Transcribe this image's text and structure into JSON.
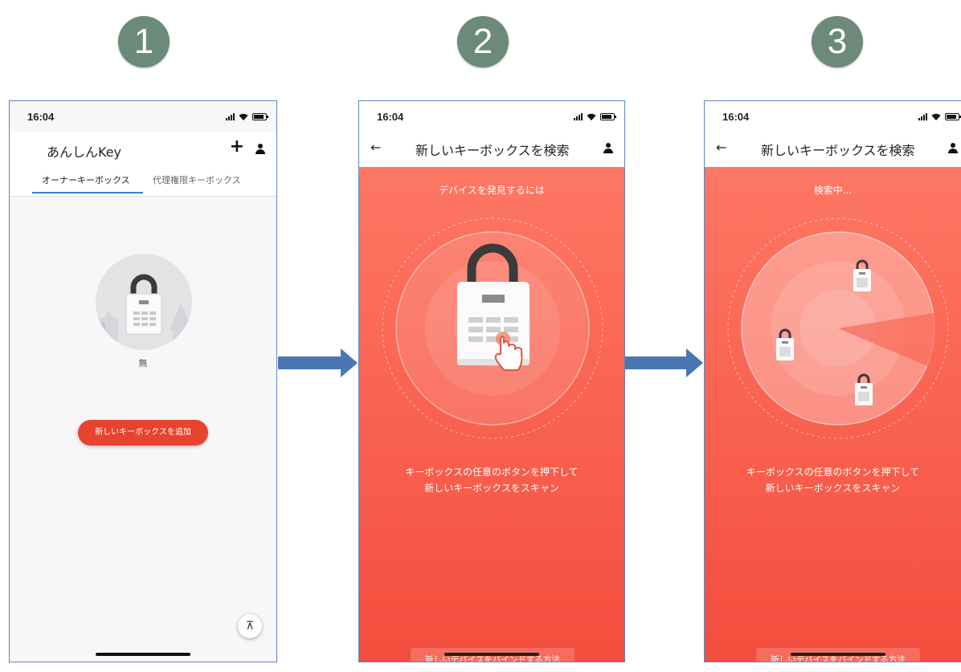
{
  "steps": [
    "1",
    "2",
    "3"
  ],
  "status_bar": {
    "time": "16:04"
  },
  "screen1": {
    "app_title": "あんしんKey",
    "plus_label": "+",
    "tabs": [
      "オーナーキーボックス",
      "代理権限キーボックス"
    ],
    "empty_text": "無",
    "add_button": "新しいキーボックスを追加",
    "scroll_top_icon": "⊼"
  },
  "screen2": {
    "back": "←",
    "title": "新しいキーボックスを検索",
    "subtitle": "デバイスを発見するには",
    "instruction_line1": "キーボックスの任意のボタンを押下して",
    "instruction_line2": "新しいキーボックスをスキャン",
    "help_button": "新しいデバイスをバインドする方法"
  },
  "screen3": {
    "back": "←",
    "title": "新しいキーボックスを検索",
    "subtitle": "検索中...",
    "instruction_line1": "キーボックスの任意のボタンを押下して",
    "instruction_line2": "新しいキーボックスをスキャン",
    "help_button": "新しいデバイスをバインドする方法"
  },
  "colors": {
    "accent_red": "#e8432f",
    "step_badge": "#6b8a7a",
    "arrow_blue": "#4a77b4",
    "tab_underline": "#3b7fd9"
  }
}
